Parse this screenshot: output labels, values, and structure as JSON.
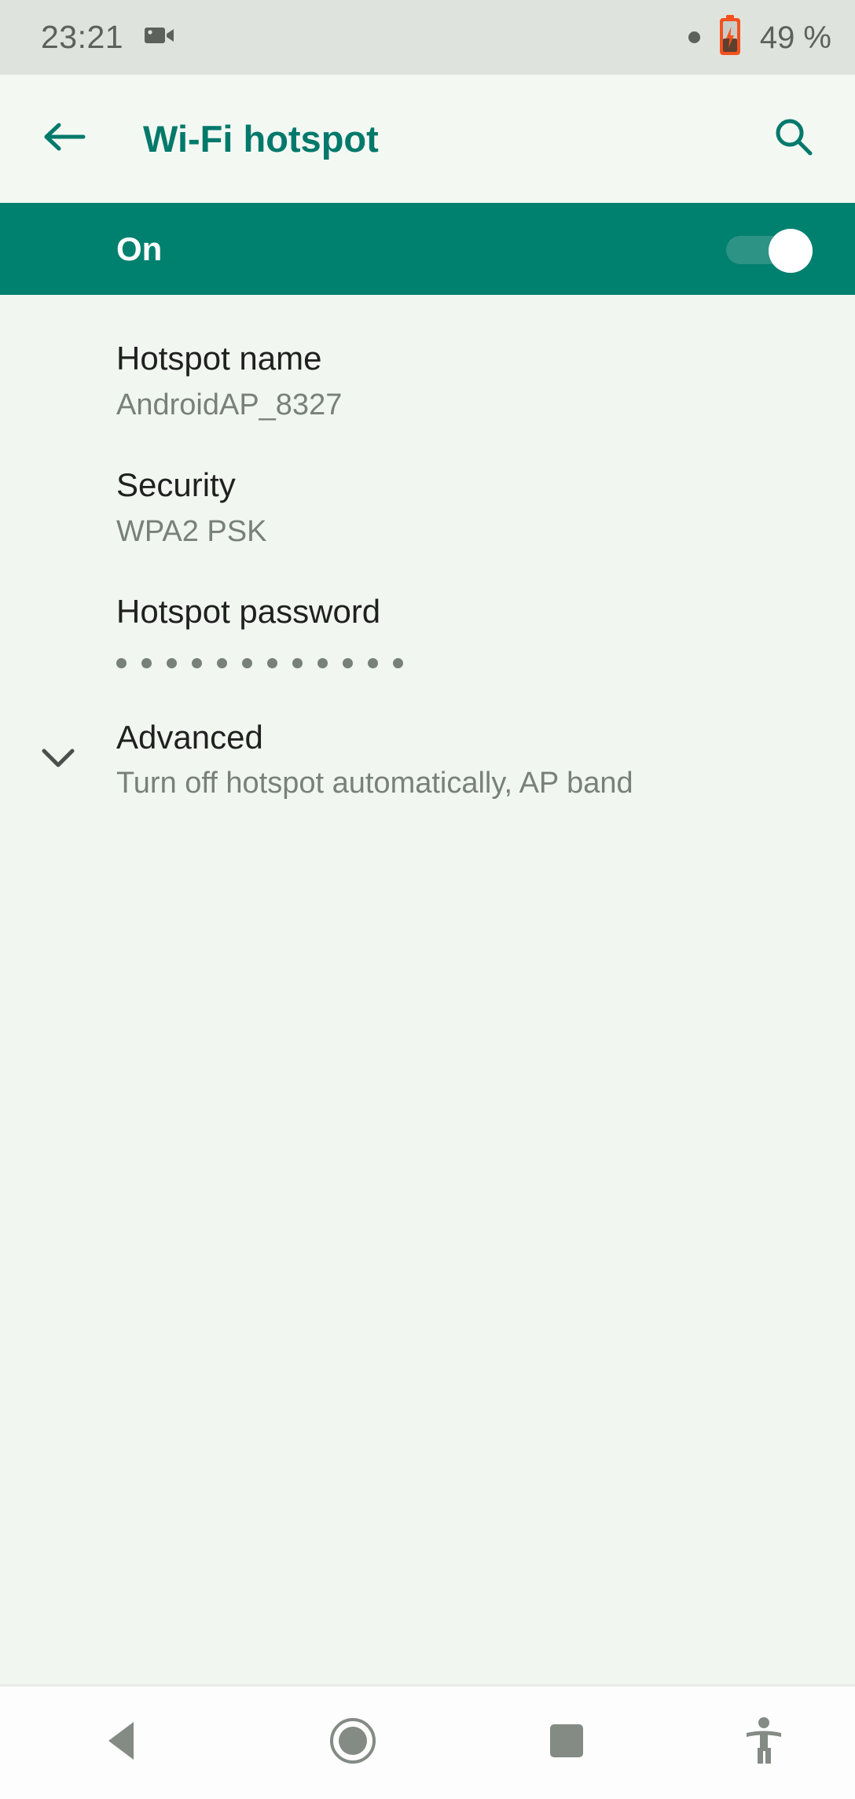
{
  "status_bar": {
    "clock": "23:21",
    "screen_record_icon": "video-camera-icon",
    "notification_dot_icon": "notification-dot-icon",
    "battery_icon": "battery-charging-icon",
    "battery_percent": "49 %",
    "colors": {
      "background": "#dfe3dd",
      "text": "#5d615c",
      "battery": "#f4511e"
    }
  },
  "app_bar": {
    "back_icon": "back-arrow-icon",
    "title": "Wi-Fi hotspot",
    "search_icon": "search-icon",
    "colors": {
      "background": "#f4f8f3",
      "accent": "#00796b"
    }
  },
  "master_switch": {
    "label": "On",
    "checked": true,
    "colors": {
      "banner": "#00806f",
      "track": "#2d9385",
      "thumb": "#ffffff",
      "label": "#ffffff"
    }
  },
  "preferences": [
    {
      "name": "hotspot-name",
      "title": "Hotspot name",
      "summary": "AndroidAP_8327",
      "has_icon": false
    },
    {
      "name": "security",
      "title": "Security",
      "summary": "WPA2 PSK",
      "has_icon": false
    },
    {
      "name": "hotspot-password",
      "title": "Hotspot password",
      "summary": "",
      "masked_dots": 12,
      "has_icon": false
    },
    {
      "name": "advanced",
      "title": "Advanced",
      "summary": "Turn off hotspot automatically, AP band",
      "has_icon": true,
      "icon": "chevron-down-icon"
    }
  ],
  "nav_bar": {
    "back_icon": "nav-back-triangle-icon",
    "home_icon": "nav-home-circle-icon",
    "recents_icon": "nav-recents-square-icon",
    "accessibility_icon": "nav-accessibility-icon",
    "colors": {
      "background": "#fcfdfc",
      "icon": "#848b84"
    }
  },
  "page": {
    "content_background": "#f2f6f1"
  }
}
